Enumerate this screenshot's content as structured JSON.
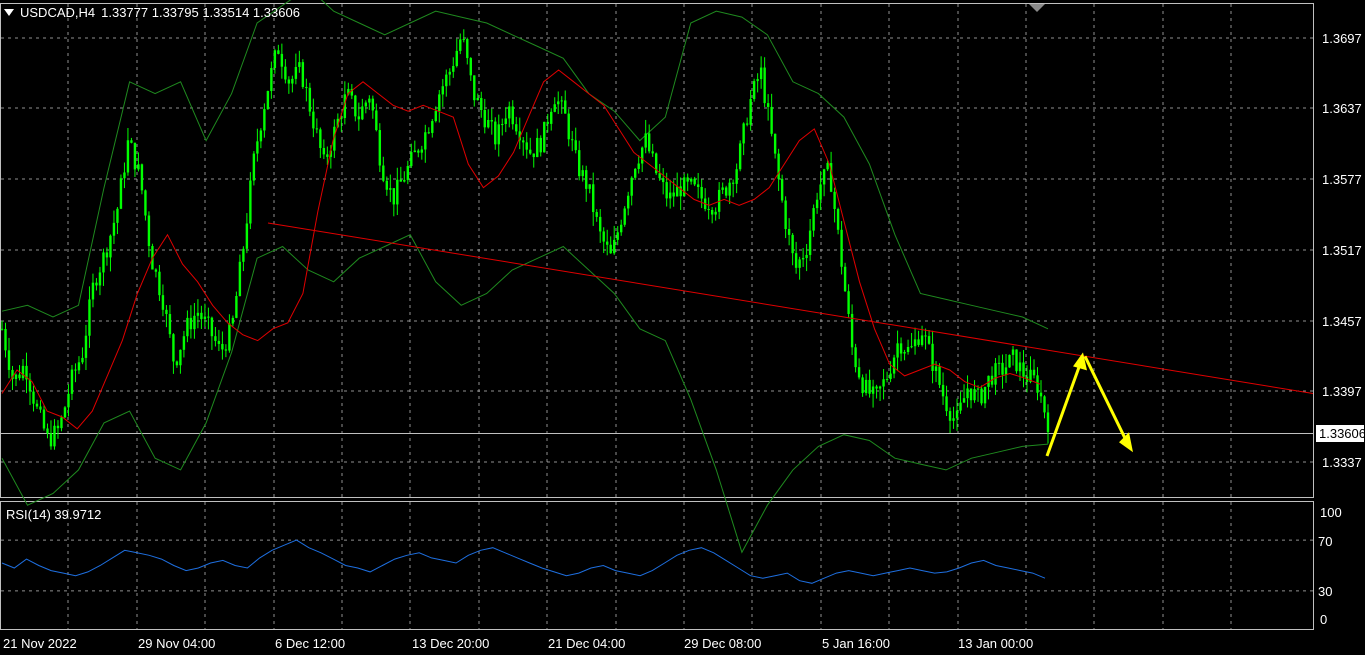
{
  "header": {
    "symbol": "USDCAD,H4",
    "ohlc": "1.33777 1.33795 1.33514 1.33606"
  },
  "colors": {
    "background": "#000000",
    "grid": "#c0c0c0",
    "candles": "#00ff00",
    "bollinger": "#1f8a1f",
    "moving_average": "#e00000",
    "trendline": "#e00000",
    "rsi": "#1e6fe0",
    "projection_arrows": "#ffff00"
  },
  "price_axis": {
    "labels": [
      "1.3697",
      "1.3637",
      "1.3577",
      "1.3517",
      "1.3457",
      "1.3397",
      "1.3337"
    ],
    "current_price": "1.33606"
  },
  "time_axis": {
    "labels": [
      "21 Nov 2022",
      "29 Nov 04:00",
      "6 Dec 12:00",
      "13 Dec 20:00",
      "21 Dec 04:00",
      "29 Dec 08:00",
      "5 Jan 16:00",
      "13 Jan 00:00"
    ]
  },
  "rsi_panel": {
    "title": "RSI(14) 39.9712",
    "levels": [
      "100",
      "70",
      "30",
      "0"
    ]
  },
  "chart_data": {
    "type": "candlestick",
    "title": "USDCAD,H4",
    "ohlc_last": [
      1.33777,
      1.33795,
      1.33514,
      1.33606
    ],
    "y_range": [
      1.3297,
      1.3717
    ],
    "close_path": [
      1.344,
      1.3395,
      1.341,
      1.3372,
      1.3345,
      1.3355,
      1.3395,
      1.342,
      1.348,
      1.3505,
      1.354,
      1.36,
      1.357,
      1.35,
      1.3465,
      1.341,
      1.344,
      1.3455,
      1.344,
      1.342,
      1.344,
      1.351,
      1.359,
      1.364,
      1.368,
      1.365,
      1.366,
      1.362,
      1.358,
      1.361,
      1.364,
      1.362,
      1.364,
      1.358,
      1.355,
      1.357,
      1.359,
      1.361,
      1.364,
      1.366,
      1.369,
      1.364,
      1.362,
      1.36,
      1.363,
      1.361,
      1.359,
      1.36,
      1.364,
      1.362,
      1.358,
      1.356,
      1.352,
      1.35,
      1.354,
      1.358,
      1.36,
      1.357,
      1.355,
      1.356,
      1.356,
      1.355,
      1.3545,
      1.356,
      1.358,
      1.363,
      1.366,
      1.36,
      1.354,
      1.349,
      1.351,
      1.356,
      1.3575,
      1.35,
      1.342,
      1.339,
      1.338,
      1.34,
      1.343,
      1.342,
      1.344,
      1.341,
      1.338,
      1.336,
      1.339,
      1.338,
      1.34,
      1.3405,
      1.3415,
      1.34,
      1.3395,
      1.3361
    ],
    "moving_average_path": [
      1.3385,
      1.3405,
      1.3395,
      1.337,
      1.3365,
      1.3355,
      1.337,
      1.34,
      1.343,
      1.347,
      1.35,
      1.352,
      1.3495,
      1.348,
      1.346,
      1.3445,
      1.3435,
      1.343,
      1.344,
      1.3445,
      1.347,
      1.354,
      1.36,
      1.364,
      1.365,
      1.364,
      1.363,
      1.3625,
      1.363,
      1.3625,
      1.362,
      1.358,
      1.356,
      1.357,
      1.359,
      1.362,
      1.365,
      1.366,
      1.365,
      1.364,
      1.363,
      1.361,
      1.359,
      1.358,
      1.357,
      1.356,
      1.355,
      1.3545,
      1.355,
      1.3545,
      1.355,
      1.356,
      1.358,
      1.36,
      1.361,
      1.358,
      1.353,
      1.348,
      1.344,
      1.341,
      1.34,
      1.3405,
      1.341,
      1.3405,
      1.3395,
      1.339,
      1.3398,
      1.3402,
      1.3398,
      1.3393
    ],
    "bollinger_upper_path": [
      1.3455,
      1.346,
      1.345,
      1.346,
      1.356,
      1.365,
      1.364,
      1.365,
      1.36,
      1.364,
      1.37,
      1.3715,
      1.373,
      1.371,
      1.37,
      1.369,
      1.37,
      1.371,
      1.3705,
      1.37,
      1.369,
      1.368,
      1.367,
      1.364,
      1.3625,
      1.36,
      1.362,
      1.37,
      1.371,
      1.3705,
      1.369,
      1.365,
      1.364,
      1.362,
      1.358,
      1.352,
      1.347,
      1.3465,
      1.346,
      1.3455,
      1.345,
      1.344
    ],
    "bollinger_lower_path": [
      1.333,
      1.329,
      1.33,
      1.332,
      1.336,
      1.337,
      1.333,
      1.332,
      1.336,
      1.342,
      1.35,
      1.351,
      1.349,
      1.348,
      1.35,
      1.351,
      1.352,
      1.348,
      1.346,
      1.347,
      1.349,
      1.35,
      1.351,
      1.349,
      1.347,
      1.344,
      1.343,
      1.338,
      1.332,
      1.325,
      1.329,
      1.332,
      1.334,
      1.335,
      1.3345,
      1.333,
      1.3325,
      1.332,
      1.333,
      1.3335,
      1.334,
      1.3342
    ],
    "trendline": {
      "from": 1.353,
      "to": 1.3385
    },
    "projection": {
      "up_to": 1.342,
      "down_to": 1.3335
    },
    "rsi_range": [
      0,
      100
    ],
    "rsi_levels": [
      70,
      30
    ],
    "rsi_last": 39.9712,
    "rsi_path": [
      52,
      48,
      55,
      50,
      46,
      44,
      42,
      45,
      50,
      56,
      62,
      60,
      58,
      55,
      50,
      46,
      48,
      52,
      54,
      50,
      48,
      56,
      62,
      66,
      70,
      64,
      60,
      55,
      50,
      48,
      45,
      50,
      55,
      58,
      60,
      56,
      54,
      52,
      58,
      62,
      64,
      60,
      56,
      52,
      48,
      45,
      42,
      44,
      48,
      50,
      46,
      44,
      42,
      46,
      52,
      58,
      62,
      64,
      60,
      54,
      48,
      42,
      40,
      42,
      44,
      38,
      36,
      40,
      44,
      46,
      44,
      42,
      44,
      46,
      48,
      46,
      44,
      45,
      48,
      52,
      54,
      50,
      48,
      46,
      44,
      40
    ]
  }
}
